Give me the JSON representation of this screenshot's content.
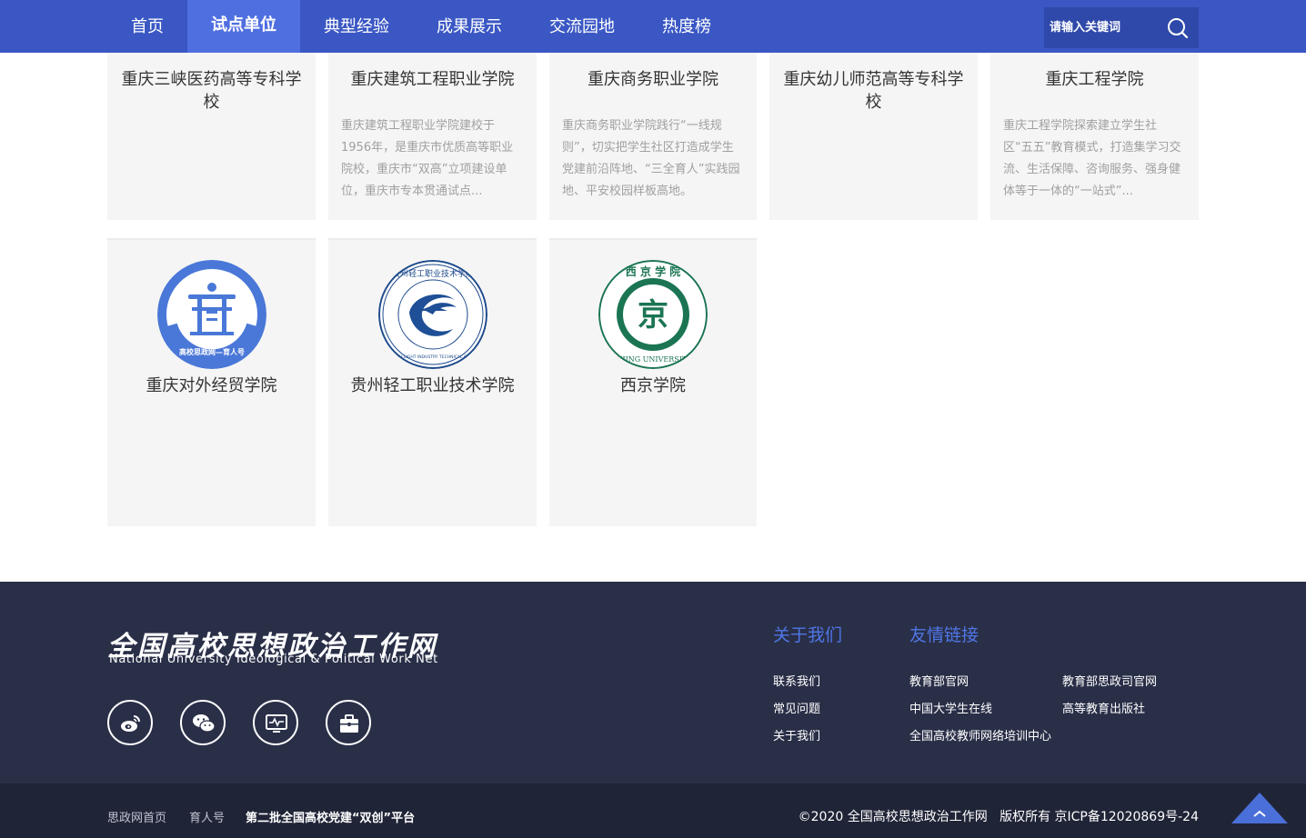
{
  "nav": {
    "items": [
      "首页",
      "试点单位",
      "典型经验",
      "成果展示",
      "交流园地",
      "热度榜"
    ],
    "active_index": 1
  },
  "search": {
    "placeholder": "请输入关键词"
  },
  "cards_row1": [
    {
      "name": "重庆三峡医药高等专科学校",
      "desc": ""
    },
    {
      "name": "重庆建筑工程职业学院",
      "desc": "重庆建筑工程职业学院建校于1956年，是重庆市优质高等职业院校，重庆市“双高”立项建设单位，重庆市专本贯通试点..."
    },
    {
      "name": "重庆商务职业学院",
      "desc": "重庆商务职业学院践行“一线规则”，切实把学生社区打造成学生党建前沿阵地、“三全育人”实践园地、平安校园样板高地。"
    },
    {
      "name": "重庆幼儿师范高等专科学校",
      "desc": ""
    },
    {
      "name": "重庆工程学院",
      "desc": "重庆工程学院探索建立学生社区“五五”教育模式，打造集学习交流、生活保障、咨询服务、强身健体等于一体的“一站式”..."
    }
  ],
  "cards_row2": [
    {
      "name": "重庆对外经贸学院",
      "logo": "yurenhao-logo",
      "logo_text": "高校思政网—育人号"
    },
    {
      "name": "贵州轻工职业技术学院",
      "logo": "guizhou-light-industry-logo",
      "logo_text": "GUIZHOU LIGHT INDUSTRY TECHNICAL COLLEGE"
    },
    {
      "name": "西京学院",
      "logo": "xijing-university-logo",
      "logo_text": "西京学院 XIJING UNIVERSITY"
    }
  ],
  "footer": {
    "brand_cn": "全国高校思想政治工作网",
    "brand_en": "National University Ideological & Political Work Net",
    "social_icons": [
      "weibo-icon",
      "wechat-icon",
      "monitor-icon",
      "briefcase-icon"
    ],
    "about": {
      "title": "关于我们",
      "links": [
        "联系我们",
        "常见问题",
        "关于我们"
      ]
    },
    "friends": {
      "title": "友情链接",
      "links": [
        "教育部官网",
        "教育部思政司官网",
        "中国大学生在线",
        "高等教育出版社",
        "全国高校教师网络培训中心"
      ]
    },
    "bottom_links": [
      "思政网首页",
      "育人号",
      "第二批全国高校党建“双创”平台"
    ],
    "copyright": "©2020 全国高校思想政治工作网   版权所有 京ICP备12020869号-24"
  },
  "colors": {
    "nav_bg": "#3a57c4",
    "nav_active": "#4f6fe0",
    "footer_bg": "#2a2f48",
    "footer_bottom": "#202437",
    "accent": "#4f76e6"
  }
}
